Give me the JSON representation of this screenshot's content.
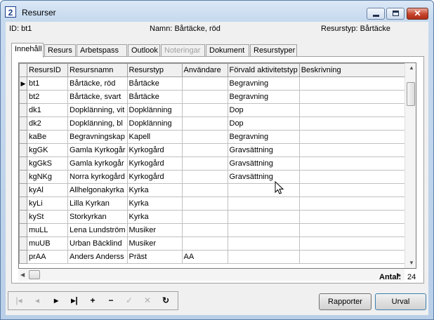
{
  "window": {
    "title": "Resurser",
    "app_icon_text": "2",
    "close_glyph": "✕"
  },
  "info": {
    "id": "ID: bt1",
    "name": "Namn: Bårtäcke, röd",
    "type": "Resurstyp: Bårtäcke"
  },
  "tabs": [
    {
      "label": "Innehåll",
      "active": true,
      "disabled": false
    },
    {
      "label": "Resurs",
      "active": false,
      "disabled": false
    },
    {
      "label": "Arbetspass",
      "active": false,
      "disabled": false
    },
    {
      "label": "Outlook",
      "active": false,
      "disabled": false
    },
    {
      "label": "Noteringar",
      "active": false,
      "disabled": true
    },
    {
      "label": "Dokument",
      "active": false,
      "disabled": false
    },
    {
      "label": "Resurstyper",
      "active": false,
      "disabled": false
    }
  ],
  "grid": {
    "columns": [
      "ResursID",
      "Resursnamn",
      "Resurstyp",
      "Användare",
      "Förvald aktivitetstyp",
      "Beskrivning"
    ],
    "current_row_marker": "▶",
    "rows": [
      [
        "bt1",
        "Bårtäcke, röd",
        "Bårtäcke",
        "",
        "Begravning",
        ""
      ],
      [
        "bt2",
        "Bårtäcke, svart",
        "Bårtäcke",
        "",
        "Begravning",
        ""
      ],
      [
        "dk1",
        "Dopklänning, vit",
        "Dopklänning",
        "",
        "Dop",
        ""
      ],
      [
        "dk2",
        "Dopklänning, bl",
        "Dopklänning",
        "",
        "Dop",
        ""
      ],
      [
        "kaBe",
        "Begravningskap",
        "Kapell",
        "",
        "Begravning",
        ""
      ],
      [
        "kgGK",
        "Gamla Kyrkogår",
        "Kyrkogård",
        "",
        "Gravsättning",
        ""
      ],
      [
        "kgGkS",
        "Gamla kyrkogår",
        "Kyrkogård",
        "",
        "Gravsättning",
        ""
      ],
      [
        "kgNKg",
        "Norra kyrkogård",
        "Kyrkogård",
        "",
        "Gravsättning",
        ""
      ],
      [
        "kyAl",
        "Allhelgonakyrka",
        "Kyrka",
        "",
        "",
        ""
      ],
      [
        "kyLi",
        "Lilla Kyrkan",
        "Kyrka",
        "",
        "",
        ""
      ],
      [
        "kySt",
        "Storkyrkan",
        "Kyrka",
        "",
        "",
        ""
      ],
      [
        "muLL",
        "Lena Lundström",
        "Musiker",
        "",
        "",
        ""
      ],
      [
        "muUB",
        "Urban Bäcklind",
        "Musiker",
        "",
        "",
        ""
      ],
      [
        "prAA",
        "Anders Anderss",
        "Präst",
        "AA",
        "",
        ""
      ]
    ]
  },
  "count": {
    "label": "Antal:",
    "value": "24"
  },
  "toolbar": {
    "buttons": [
      {
        "icon": "first-record-icon",
        "glyph": "|◂",
        "enabled": false
      },
      {
        "icon": "previous-record-icon",
        "glyph": "◂",
        "enabled": false
      },
      {
        "icon": "next-record-icon",
        "glyph": "▸",
        "enabled": true
      },
      {
        "icon": "last-record-icon",
        "glyph": "▸|",
        "enabled": true
      },
      {
        "icon": "add-record-icon",
        "glyph": "+",
        "enabled": true
      },
      {
        "icon": "delete-record-icon",
        "glyph": "−",
        "enabled": true
      },
      {
        "icon": "save-record-icon",
        "glyph": "✓",
        "enabled": false
      },
      {
        "icon": "cancel-record-icon",
        "glyph": "✕",
        "enabled": false
      },
      {
        "icon": "refresh-icon",
        "glyph": "↻",
        "enabled": true
      }
    ]
  },
  "buttons": {
    "reports": "Rapporter",
    "selection": "Urval"
  }
}
